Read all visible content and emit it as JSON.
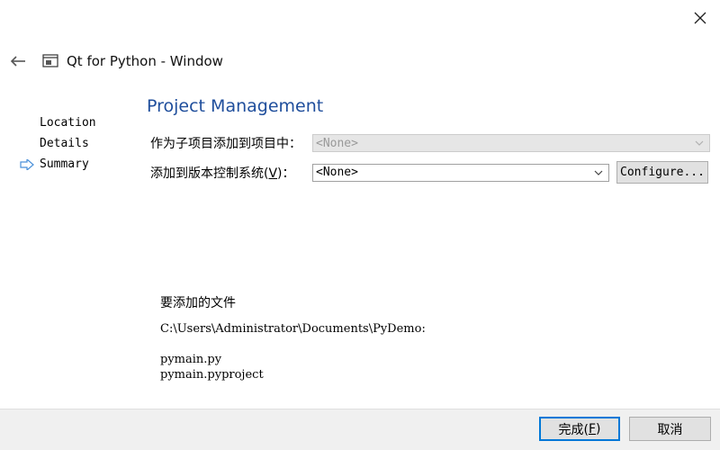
{
  "window": {
    "title": "Qt for Python - Window",
    "close_symbol": "✕",
    "back_icon": "arrow-left-icon",
    "app_icon": "window-icon"
  },
  "steps": [
    {
      "label": "Location",
      "current": false
    },
    {
      "label": "Details",
      "current": false
    },
    {
      "label": "Summary",
      "current": true
    }
  ],
  "page": {
    "title": "Project Management"
  },
  "form": {
    "add_subproject": {
      "label": "作为子项目添加到项目中：",
      "value": "<None>",
      "disabled": true
    },
    "vcs": {
      "label_prefix": "添加到版本控制系统(",
      "label_mnemonic": "V",
      "label_suffix": ")：",
      "value": "<None>",
      "configure_label": "Configure..."
    }
  },
  "files": {
    "title": "要添加的文件",
    "path": "C:\\Users\\Administrator\\Documents\\PyDemo:",
    "list": [
      "pymain.py",
      "pymain.pyproject"
    ]
  },
  "footer": {
    "finish": {
      "prefix": "完成(",
      "mnemonic": "F",
      "suffix": ")"
    },
    "cancel": "取消"
  },
  "colors": {
    "title": "#1f4e9c",
    "arrow": "#4a90d9",
    "focus": "#0078d7"
  }
}
